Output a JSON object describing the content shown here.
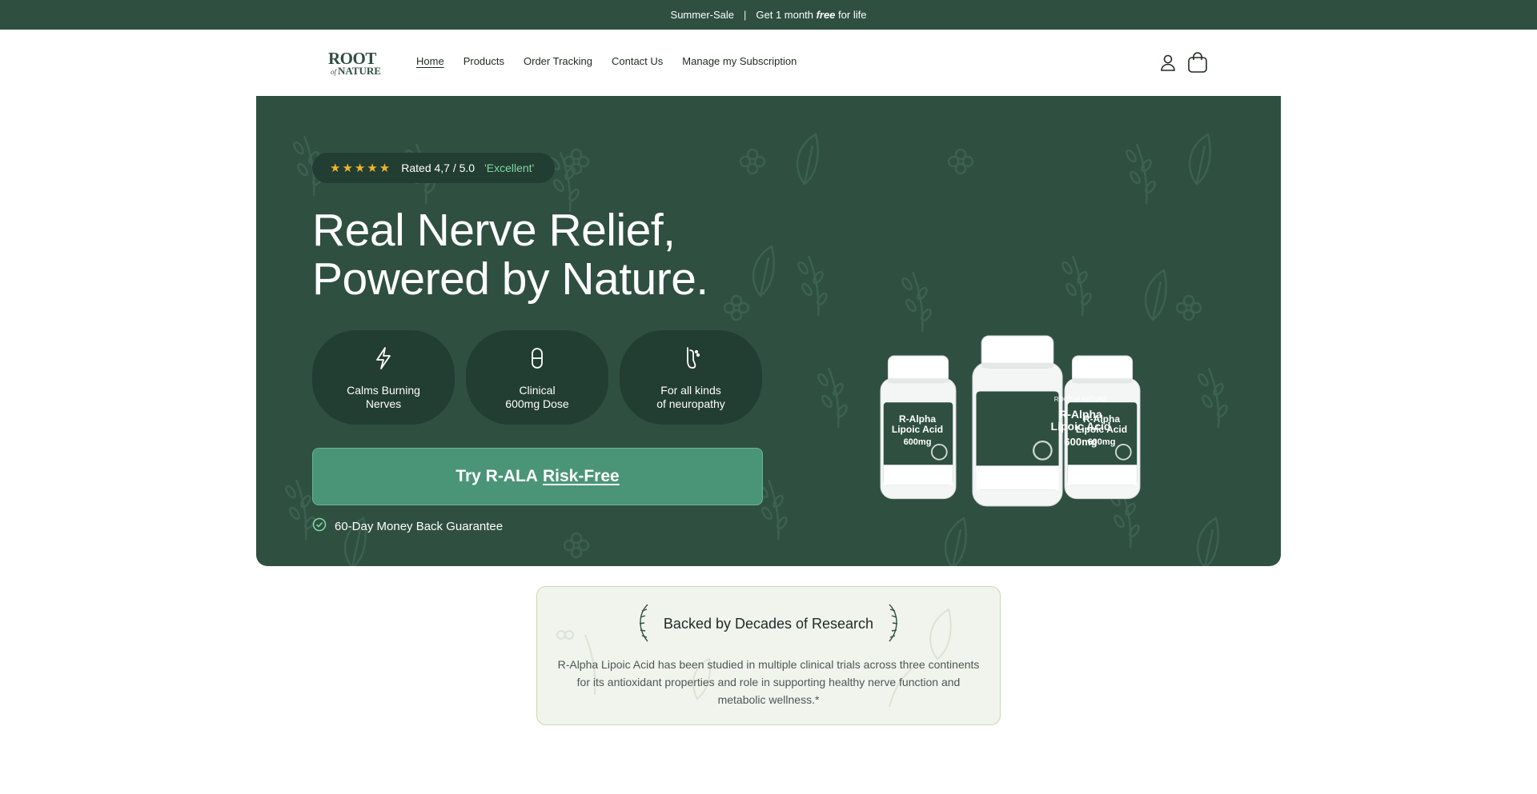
{
  "announcement": {
    "left": "Summer-Sale",
    "separator": "|",
    "right_prefix": "Get 1 month",
    "right_emphasis": "free",
    "right_suffix": "for life"
  },
  "header": {
    "logo_line1": "ROOT",
    "logo_line2_small": "of",
    "logo_line2": "NATURE",
    "nav": [
      {
        "label": "Home",
        "active": true
      },
      {
        "label": "Products"
      },
      {
        "label": "Order Tracking"
      },
      {
        "label": "Contact Us"
      },
      {
        "label": "Manage my Subscription"
      }
    ],
    "icons": [
      "account-icon",
      "cart-icon"
    ]
  },
  "hero": {
    "rating": {
      "stars": "★★★★★",
      "stars_count": 5,
      "text": "Rated 4,7 / 5.0",
      "quality": "'Excellent'"
    },
    "headline_line1": "Real Nerve Relief,",
    "headline_line2": "Powered by Nature.",
    "features": [
      {
        "icon": "lightning-icon",
        "line1": "Calms Burning",
        "line2": "Nerves"
      },
      {
        "icon": "capsule-icon",
        "line1": "Clinical",
        "line2": "600mg Dose"
      },
      {
        "icon": "foot-icon",
        "line1": "For all kinds",
        "line2": "of neuropathy"
      }
    ],
    "cta_prefix": "Try R-ALA",
    "cta_underlined": "Risk-Free",
    "guarantee": "60-Day Money Back Guarantee",
    "product": {
      "brand": "ROOT of NATURE",
      "name_line1": "R-Alpha",
      "name_line2": "Lipoic Acid",
      "dose": "600mg"
    }
  },
  "research": {
    "title": "Backed by Decades of Research",
    "body": "R-Alpha Lipoic Acid has been studied in multiple clinical trials across three continents for its antioxidant properties and role in supporting healthy nerve function and metabolic wellness.*"
  },
  "colors": {
    "brand_green": "#2f4f41",
    "dark_pill": "#223d32",
    "cta_green": "#4a9577",
    "star_gold": "#f0b429",
    "excellent_green": "#7fd6a3",
    "card_bg": "#f1f4ec"
  }
}
